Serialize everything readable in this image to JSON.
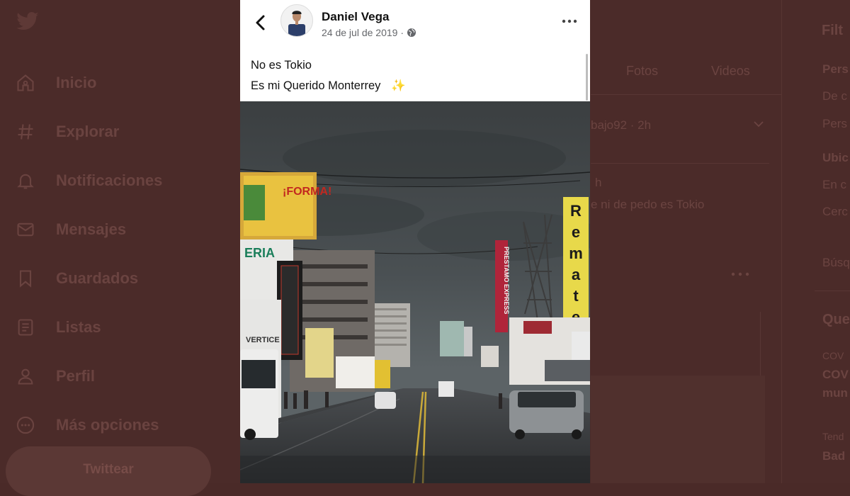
{
  "twitter_nav": {
    "items": [
      {
        "label": "Inicio",
        "icon": "home-icon"
      },
      {
        "label": "Explorar",
        "icon": "hashtag-icon"
      },
      {
        "label": "Notificaciones",
        "icon": "bell-icon"
      },
      {
        "label": "Mensajes",
        "icon": "mail-icon"
      },
      {
        "label": "Guardados",
        "icon": "bookmark-icon"
      },
      {
        "label": "Listas",
        "icon": "list-icon"
      },
      {
        "label": "Perfil",
        "icon": "person-icon"
      },
      {
        "label": "Más opciones",
        "icon": "more-circle-icon"
      }
    ],
    "tweet_button": "Twittear"
  },
  "twitter_middle": {
    "tab_photos": "Fotos",
    "tab_videos": "Videos",
    "tweet_meta": "bajo92 · 2h",
    "tweet_handle": "h",
    "tweet_text": "e ni de pedo es Tokio"
  },
  "twitter_right": {
    "title": "Filt",
    "people_heading": "Pers",
    "people_opt1": "De c",
    "people_opt2": "Pers",
    "location_heading": "Ubic",
    "location_opt1": "En c",
    "location_opt2": "Cerc",
    "search_link": "Búsq",
    "trends_heading": "Que",
    "trend1_label": "COV",
    "trend1_title": "COV",
    "trend1_sub": "mun",
    "trend2_label": "Tend",
    "trend2_title": "Bad"
  },
  "post": {
    "author": "Daniel Vega",
    "date": "24 de jul de 2019 ·",
    "line1": "No es Tokio",
    "line2": "Es mi Querido Monterrey",
    "sparkle": "✨"
  },
  "photo_signs": {
    "remate": [
      "R",
      "e",
      "m",
      "a",
      "t",
      "e"
    ],
    "forma": "¡FORMA!",
    "teria": "ERIA",
    "vertice": "VERTICE",
    "express": "PRESTAMO EXPRESS"
  },
  "colors": {
    "overlay_bg": "#4b2b29",
    "card_bg": "#ffffff",
    "sky": "#3a3f41"
  }
}
